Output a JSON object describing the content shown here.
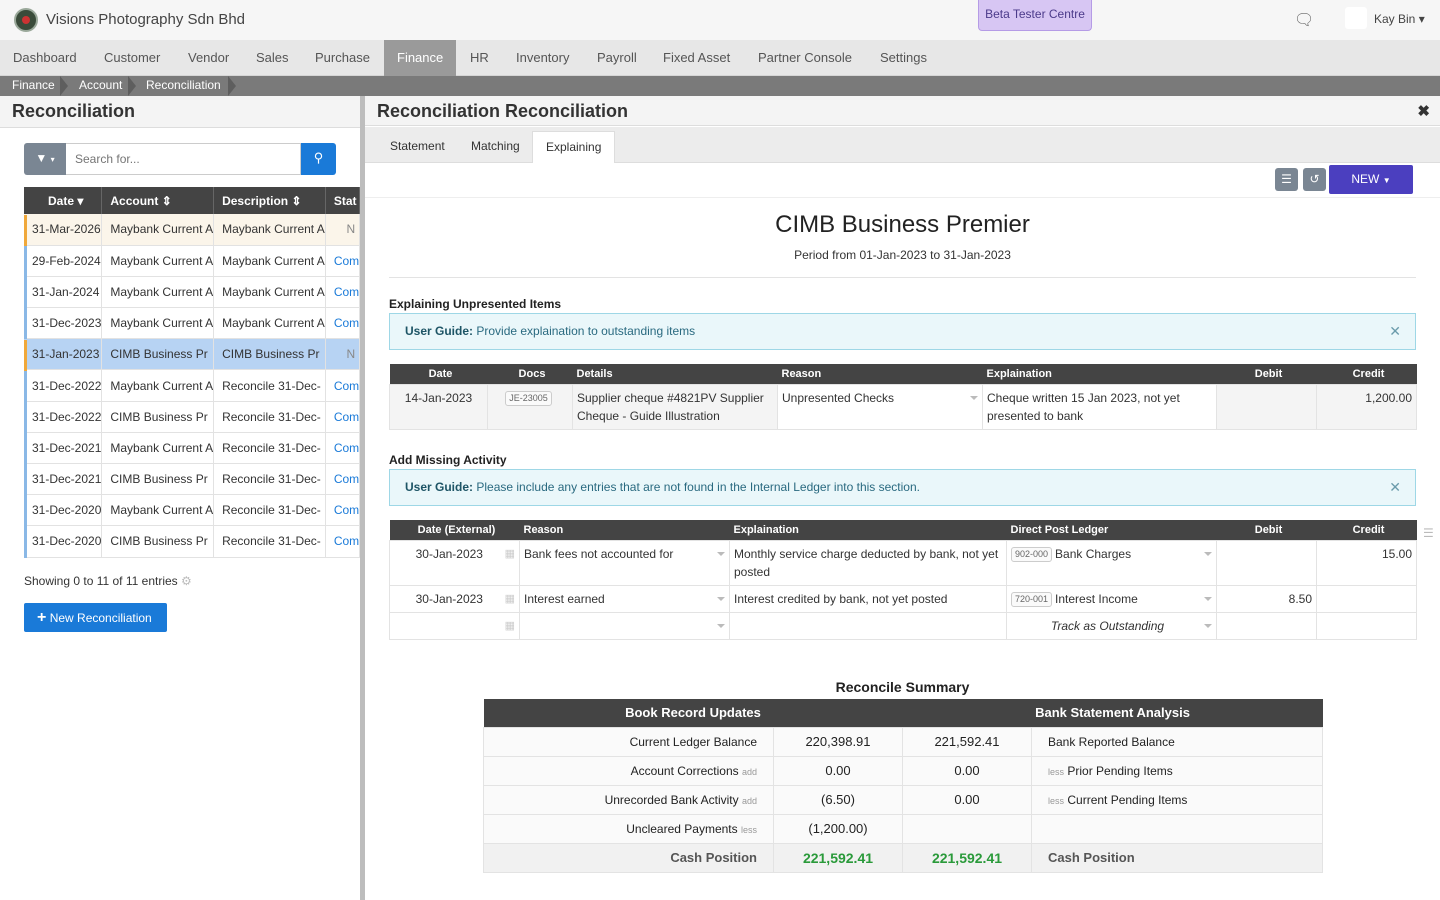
{
  "app": {
    "company": "Visions Photography Sdn Bhd",
    "beta": "Beta Tester Centre",
    "user": "Kay Bin ▾"
  },
  "nav": [
    "Dashboard",
    "Customer",
    "Vendor",
    "Sales",
    "Purchase",
    "Finance",
    "HR",
    "Inventory",
    "Payroll",
    "Fixed Asset",
    "Partner Console",
    "Settings"
  ],
  "breadcrumb": [
    "Finance",
    "Account",
    "Reconciliation"
  ],
  "left": {
    "title": "Reconciliation",
    "search_placeholder": "Search for...",
    "columns": [
      "Date ▾",
      "Account ⇕",
      "Description ⇕",
      "Stat"
    ],
    "rows": [
      {
        "date": "31-Mar-2026",
        "account": "Maybank Current A",
        "description": "Maybank Current A",
        "status": "N"
      },
      {
        "date": "29-Feb-2024",
        "account": "Maybank Current A",
        "description": "Maybank Current A",
        "status": "Com"
      },
      {
        "date": "31-Jan-2024",
        "account": "Maybank Current A",
        "description": "Maybank Current A",
        "status": "Com"
      },
      {
        "date": "31-Dec-2023",
        "account": "Maybank Current A",
        "description": "Maybank Current A",
        "status": "Com"
      },
      {
        "date": "31-Jan-2023",
        "account": "CIMB Business Pr",
        "description": "CIMB Business Pr",
        "status": "N"
      },
      {
        "date": "31-Dec-2022",
        "account": "Maybank Current A",
        "description": "Reconcile 31-Dec-",
        "status": "Com"
      },
      {
        "date": "31-Dec-2022",
        "account": "CIMB Business Pr",
        "description": "Reconcile 31-Dec-",
        "status": "Com"
      },
      {
        "date": "31-Dec-2021",
        "account": "Maybank Current A",
        "description": "Reconcile 31-Dec-",
        "status": "Com"
      },
      {
        "date": "31-Dec-2021",
        "account": "CIMB Business Pr",
        "description": "Reconcile 31-Dec-",
        "status": "Com"
      },
      {
        "date": "31-Dec-2020",
        "account": "Maybank Current A",
        "description": "Reconcile 31-Dec-",
        "status": "Com"
      },
      {
        "date": "31-Dec-2020",
        "account": "CIMB Business Pr",
        "description": "Reconcile 31-Dec-",
        "status": "Com"
      }
    ],
    "showing": "Showing 0 to 11 of 11 entries",
    "new_button": "New Reconciliation"
  },
  "right": {
    "title": "Reconciliation Reconciliation",
    "tabs": [
      "Statement",
      "Matching",
      "Explaining"
    ],
    "new_button": "NEW",
    "bank_name": "CIMB Business Premier",
    "period": "Period from 01-Jan-2023 to 31-Jan-2023",
    "unpresented": {
      "title": "Explaining Unpresented Items",
      "guide_label": "User Guide:",
      "guide_text": "Provide explaination to outstanding items",
      "columns": [
        "Date",
        "Docs",
        "Details",
        "Reason",
        "Explaination",
        "Debit",
        "Credit"
      ],
      "rows": [
        {
          "date": "14-Jan-2023",
          "doc": "JE-23005",
          "details": "Supplier cheque #4821PV Supplier Cheque - Guide Illustration",
          "reason": "Unpresented Checks",
          "explanation": "Cheque written 15 Jan 2023, not yet presented to bank",
          "debit": "",
          "credit": "1,200.00"
        }
      ]
    },
    "missing": {
      "title": "Add Missing Activity",
      "guide_label": "User Guide:",
      "guide_text": "Please include any entries that are not found in the Internal Ledger into this section.",
      "columns": [
        "Date (External)",
        "Reason",
        "Explaination",
        "Direct Post Ledger",
        "Debit",
        "Credit"
      ],
      "rows": [
        {
          "date": "30-Jan-2023",
          "reason": "Bank fees not accounted for",
          "explanation": "Monthly service charge deducted by bank, not yet posted",
          "ledger_code": "902-000",
          "ledger": "Bank Charges",
          "debit": "",
          "credit": "15.00"
        },
        {
          "date": "30-Jan-2023",
          "reason": "Interest earned",
          "explanation": "Interest credited by bank, not yet posted",
          "ledger_code": "720-001",
          "ledger": "Interest Income",
          "debit": "8.50",
          "credit": ""
        }
      ],
      "placeholder": "Track as Outstanding"
    },
    "summary": {
      "title": "Reconcile Summary",
      "left_header": "Book Record Updates",
      "right_header": "Bank Statement Analysis",
      "rows": [
        {
          "label": "Current Ledger Balance",
          "label_note": "",
          "book": "220,398.91",
          "bank": "221,592.41",
          "bank_note": "",
          "bank_label": "Bank Reported Balance"
        },
        {
          "label": "Account Corrections",
          "label_note": "add",
          "book": "0.00",
          "bank": "0.00",
          "bank_note": "less",
          "bank_label": "Prior Pending Items"
        },
        {
          "label": "Unrecorded Bank Activity",
          "label_note": "add",
          "book": "(6.50)",
          "bank": "0.00",
          "bank_note": "less",
          "bank_label": "Current Pending Items"
        },
        {
          "label": "Uncleared Payments",
          "label_note": "less",
          "book": "(1,200.00)",
          "bank": "",
          "bank_note": "",
          "bank_label": ""
        }
      ],
      "cash_label": "Cash Position",
      "cash_book": "221,592.41",
      "cash_bank": "221,592.41",
      "cash_label_right": "Cash Position"
    }
  }
}
